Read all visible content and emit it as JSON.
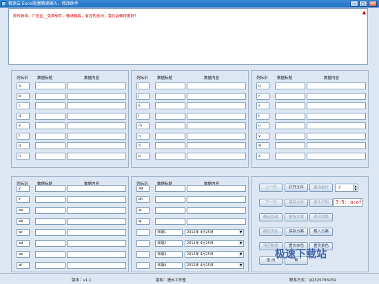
{
  "window": {
    "title": "极速云 Excel批量数据输入、修改助手",
    "min": "—",
    "max": "□",
    "close": "×"
  },
  "notice": {
    "text": "即时新闻、广告区__免费软件，敬请赐稿，有您的支持，我们会做得更好！",
    "scroll_glyph": "▲"
  },
  "headers": {
    "key": "列标识",
    "title": "数据标题",
    "content": "数据内容"
  },
  "panel1": [
    {
      "key": "a"
    },
    {
      "key": "b"
    },
    {
      "key": "c"
    },
    {
      "key": "d"
    },
    {
      "key": "e"
    },
    {
      "key": "f"
    },
    {
      "key": "g"
    },
    {
      "key": "h"
    }
  ],
  "panel2": [
    {
      "key": "i"
    },
    {
      "key": "j"
    },
    {
      "key": "k"
    },
    {
      "key": "l"
    },
    {
      "key": "m"
    },
    {
      "key": "n"
    },
    {
      "key": "o"
    },
    {
      "key": "p"
    }
  ],
  "panel3": [
    {
      "key": "q"
    },
    {
      "key": "r"
    },
    {
      "key": "s"
    },
    {
      "key": "t"
    },
    {
      "key": "u"
    },
    {
      "key": "v"
    },
    {
      "key": "w"
    },
    {
      "key": "x"
    }
  ],
  "panel4": [
    {
      "key": "y"
    },
    {
      "key": "z"
    },
    {
      "key": "aa"
    },
    {
      "key": "ab"
    },
    {
      "key": "ac"
    },
    {
      "key": "ad"
    },
    {
      "key": "ae"
    },
    {
      "key": "af"
    }
  ],
  "panel5": [
    {
      "key": "ag"
    },
    {
      "key": "ah"
    },
    {
      "key": "ai"
    },
    {
      "key": "aj"
    }
  ],
  "dates": [
    {
      "label": "日期1",
      "value": "2012年 4月25日"
    },
    {
      "label": "日期2",
      "value": "2012年 4月25日"
    },
    {
      "label": "日期3",
      "value": "2012年 4月25日"
    },
    {
      "label": "日期4",
      "value": "2012年 4月25日"
    }
  ],
  "controls": {
    "prev_row": "上一行",
    "open_file": "打开文件",
    "set_current_row": "置当前行",
    "row_number": "2",
    "next_row": "下一行",
    "save_file": "保存文件",
    "table_row_count": "表头行列",
    "clock": "3:5: a:af",
    "confirm_edit": "确定修改",
    "delete_scheme": "删除方案",
    "detail_switch": "明词切换",
    "confirm_add": "确定添加",
    "save_scheme": "保存方案",
    "load_scheme": "载入方案",
    "clear_data": "清空数据",
    "set_bg_color": "置文本色",
    "set_fg_color": "置背景色",
    "exit": "退 出",
    "more": "帮"
  },
  "status": {
    "version": "版本：v1.1",
    "copyright": "版权：漫云工作室",
    "contact": "联系方式：QQ325783159"
  },
  "watermark": "极速下载站"
}
